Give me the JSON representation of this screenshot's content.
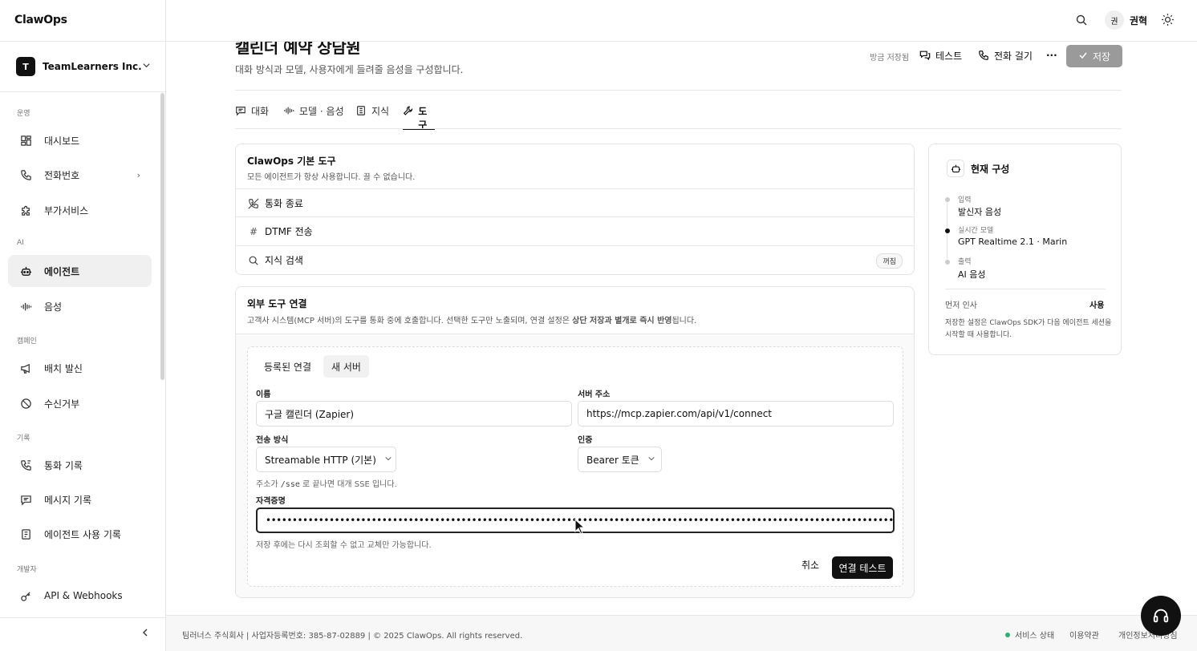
{
  "app": {
    "brand": "ClawOps"
  },
  "org": {
    "avatar_letter": "T",
    "name": "TeamLearners Inc."
  },
  "sidebar": {
    "sections": {
      "ops": "운영",
      "ai": "AI",
      "campaign": "캠페인",
      "records": "기록",
      "dev": "개발자"
    },
    "items": [
      {
        "label": "대시보드",
        "icon": "dashboard-icon"
      },
      {
        "label": "전화번호",
        "icon": "phone-icon"
      },
      {
        "label": "부가서비스",
        "icon": "puzzle-icon"
      },
      {
        "label": "에이전트",
        "icon": "robot-icon",
        "active": true
      },
      {
        "label": "음성",
        "icon": "waveform-icon"
      },
      {
        "label": "배치 발신",
        "icon": "megaphone-icon"
      },
      {
        "label": "수신거부",
        "icon": "ban-icon"
      },
      {
        "label": "통화 기록",
        "icon": "phone-log-icon"
      },
      {
        "label": "메시지 기록",
        "icon": "message-icon"
      },
      {
        "label": "에이전트 사용 기록",
        "icon": "receipt-icon"
      },
      {
        "label": "API & Webhooks",
        "icon": "key-icon"
      }
    ]
  },
  "topbar": {
    "avatar_initial": "권",
    "user_name": "권혁"
  },
  "header": {
    "title": "캘린더 예약 상담원",
    "subtitle": "대화 방식과 모델, 사용자에게 들려줄 음성을 구성합니다.",
    "saved_status": "방금 저장됨",
    "test_label": "테스트",
    "call_label": "전화 걸기",
    "more_label": "···",
    "save_label": "저장"
  },
  "tabs": [
    {
      "label": "대화",
      "icon": "chat-icon"
    },
    {
      "label": "모델 · 음성",
      "icon": "waveform-icon"
    },
    {
      "label": "지식",
      "icon": "document-icon"
    },
    {
      "label": "도구",
      "icon": "wrench-icon",
      "active": true
    }
  ],
  "builtin_tools": {
    "title": "ClawOps 기본 도구",
    "description": "모든 에이전트가 항상 사용합니다. 끌 수 없습니다.",
    "tools": [
      {
        "label": "통화 종료",
        "icon": "phone-off-icon"
      },
      {
        "label": "DTMF 전송",
        "icon": "hash-icon",
        "glyph": "#"
      },
      {
        "label": "지식 검색",
        "icon": "search-icon",
        "badge": "꺼짐"
      }
    ]
  },
  "external": {
    "title": "외부 도구 연결",
    "description_pre": "고객사 시스템(MCP 서버)의 도구를 통화 중에 호출합니다. 선택한 도구만 노출되며, 연결 설정은 ",
    "description_bold": "상단 저장과 별개로 즉시 반영",
    "description_post": "됩니다.",
    "subtabs": [
      "등록된 연결",
      "새 서버"
    ],
    "name_label": "이름",
    "name_value": "구글 캘린더 (Zapier)",
    "url_label": "서버 주소",
    "url_value": "https://mcp.zapier.com/api/v1/connect",
    "transport_label": "전송 방식",
    "transport_value": "Streamable HTTP (기본)",
    "auth_label": "인증",
    "auth_value": "Bearer 토큰",
    "hint_pre": "주소가 ",
    "hint_code": "/sse",
    "hint_post": " 로 끝나면 대개 SSE 입니다.",
    "cred_label": "자격증명",
    "cred_value": "••••••••••••••••••••••••••••••••••••••••••••••••••••••••••••••••••••••••••••••••••••••••••••••••••••••••••••••••••••••••••••",
    "cred_hint": "저장 후에는 다시 조회할 수 없고 교체만 가능합니다.",
    "cancel_label": "취소",
    "test_label": "연결 테스트"
  },
  "current_config": {
    "title": "현재 구성",
    "steps": [
      {
        "label": "입력",
        "value": "발신자 음성"
      },
      {
        "label": "실시간 모델",
        "value": "GPT Realtime 2.1 · Marin"
      },
      {
        "label": "출력",
        "value": "AI 음성"
      }
    ],
    "greeting_label": "먼저 인사",
    "greeting_value": "사용",
    "note": "저장한 설정은 ClawOps SDK가 다음 에이전트 세션을 시작할 때 사용합니다."
  },
  "footer": {
    "company": "팀러너스 주식회사 | 사업자등록번호: 385-87-02889 | © 2025 ClawOps. All rights reserved.",
    "status": "서비스 상태",
    "terms": "이용약관",
    "privacy": "개인정보처리방침"
  },
  "colors": {
    "accent": "#111111",
    "save_disabled": "#9a9a9a",
    "status_green": "#22b573"
  }
}
